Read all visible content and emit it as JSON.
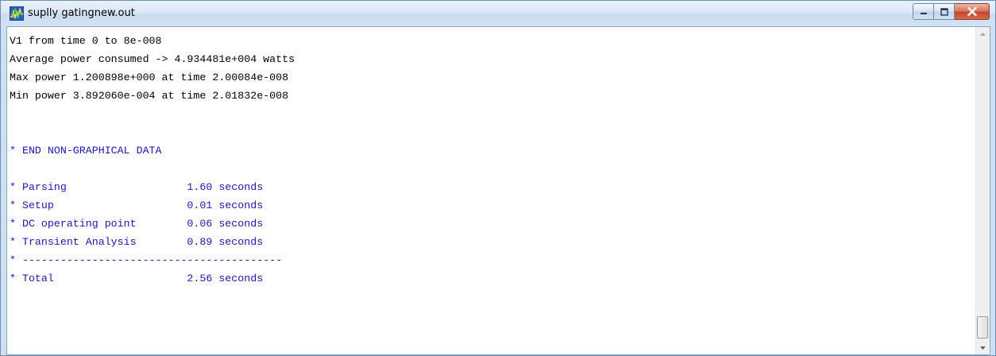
{
  "window": {
    "title": "suplly gatingnew.out",
    "app_icon": "spice-waveform-icon",
    "buttons": [
      "minimize",
      "maximize",
      "close"
    ]
  },
  "output": {
    "lines": [
      {
        "text": "V1 from time 0 to 8e-008",
        "kind": "normal"
      },
      {
        "text": "Average power consumed -> 4.934481e+004 watts",
        "kind": "normal"
      },
      {
        "text": "Max power 1.200898e+000 at time 2.00084e-008",
        "kind": "normal"
      },
      {
        "text": "Min power 3.892060e-004 at time 2.01832e-008",
        "kind": "normal"
      },
      {
        "text": "",
        "kind": "blank"
      },
      {
        "text": "",
        "kind": "blank"
      },
      {
        "text": "* END NON-GRAPHICAL DATA",
        "kind": "comment"
      },
      {
        "text": "",
        "kind": "blank"
      },
      {
        "text": "* Parsing                   1.60 seconds",
        "kind": "comment"
      },
      {
        "text": "* Setup                     0.01 seconds",
        "kind": "comment"
      },
      {
        "text": "* DC operating point        0.06 seconds",
        "kind": "comment"
      },
      {
        "text": "* Transient Analysis        0.89 seconds",
        "kind": "comment"
      },
      {
        "text": "* -----------------------------------------",
        "kind": "comment"
      },
      {
        "text": "* Total                     2.56 seconds",
        "kind": "comment"
      }
    ]
  },
  "colors": {
    "comment_text": "#1b18b6",
    "normal_text": "#000000",
    "close_button": "#c4462a"
  }
}
